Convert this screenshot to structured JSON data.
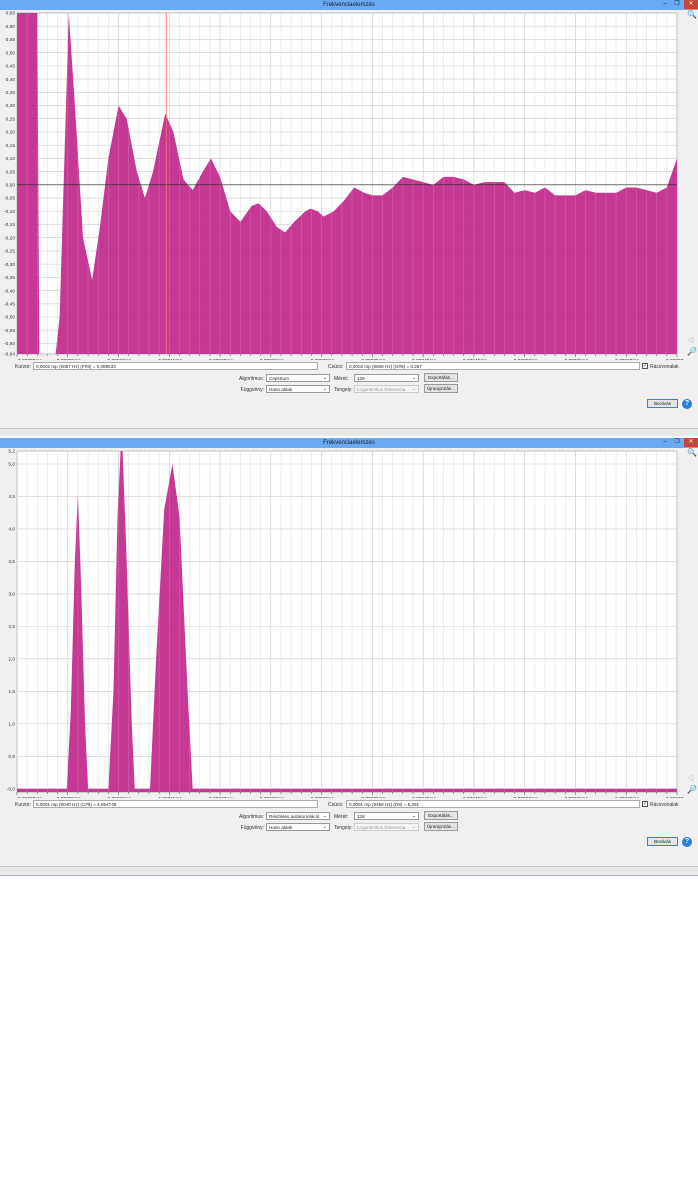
{
  "colors": {
    "fill": "#c22e8f",
    "titlebar": "#6aaaf2",
    "cursor_line": "#ff7070"
  },
  "windows": [
    {
      "title": "Frekvenciaelemzés",
      "cursor_label": "Kurzor:",
      "cursor_value": "0,0002 mp (6057 Hz) (F#8) = 0,088533",
      "peak_label": "Csúcs:",
      "peak_value": "0,0002 mp (6609 Hz) (G#8) = 0,287",
      "grid_label": "Rácsvonalak",
      "grid_checked": true,
      "algorithm_label": "Algoritmus:",
      "algorithm_value": "Cepstrum",
      "size_label": "Méret:",
      "size_value": "128",
      "export_label": "Exportálás...",
      "function_label": "Függvény:",
      "function_value": "Hann ablak",
      "axis_label": "Tengely:",
      "axis_value": "Logaritmikus frekvencia",
      "replot_label": "Újrarajzolás...",
      "close_label": "Bezárás",
      "help_icon": "?"
    },
    {
      "title": "Frekvenciaelemzés",
      "cursor_label": "Kurzor:",
      "cursor_value": "0,0001 mp (9040 Hz) (C#9) = 4,654749",
      "peak_label": "Csúcs:",
      "peak_value": "0,0001 mp (9458 Hz) (D9) = 5,291",
      "grid_label": "Rácsvonalak",
      "grid_checked": true,
      "algorithm_label": "Algoritmus:",
      "algorithm_value": "Részletes autokorreláció",
      "size_label": "Méret:",
      "size_value": "128",
      "export_label": "Exportálás...",
      "function_label": "Függvény:",
      "function_value": "Hann ablak",
      "axis_label": "Tengely:",
      "axis_value": "Logaritmikus frekvencia",
      "replot_label": "Újrarajzolás...",
      "close_label": "Bezárás",
      "help_icon": "?"
    }
  ],
  "chart_data": [
    {
      "type": "area",
      "title": "Cepstrum",
      "xlabel": "mp",
      "ylabel": "",
      "xlim": [
        0,
        0.00065
      ],
      "ylim": [
        -0.64,
        0.65
      ],
      "x_ticks": [
        "0,00000mp",
        "0,00005mp",
        "0,00010mp",
        "0,00015mp",
        "0,00020mp",
        "0,00025mp",
        "0,00030mp",
        "0,00035mp",
        "0,00040mp",
        "0,00045mp",
        "0,00050mp",
        "0,00055mp",
        "0,00060mp",
        "0,00065mp"
      ],
      "y_ticks": [
        {
          "v": 0.65,
          "t": "0,65"
        },
        {
          "v": 0.6,
          "t": "0,60"
        },
        {
          "v": 0.55,
          "t": "0,55"
        },
        {
          "v": 0.5,
          "t": "0,50"
        },
        {
          "v": 0.45,
          "t": "0,45"
        },
        {
          "v": 0.4,
          "t": "0,40"
        },
        {
          "v": 0.35,
          "t": "0,35"
        },
        {
          "v": 0.3,
          "t": "0,30"
        },
        {
          "v": 0.25,
          "t": "0,25"
        },
        {
          "v": 0.2,
          "t": "0,20"
        },
        {
          "v": 0.15,
          "t": "0,15"
        },
        {
          "v": 0.1,
          "t": "0,10"
        },
        {
          "v": 0.05,
          "t": "0,05"
        },
        {
          "v": 0,
          "t": "0,00"
        },
        {
          "v": -0.05,
          "t": "-0,05"
        },
        {
          "v": -0.1,
          "t": "-0,10"
        },
        {
          "v": -0.15,
          "t": "-0,15"
        },
        {
          "v": -0.2,
          "t": "-0,20"
        },
        {
          "v": -0.25,
          "t": "-0,25"
        },
        {
          "v": -0.3,
          "t": "-0,30"
        },
        {
          "v": -0.35,
          "t": "-0,35"
        },
        {
          "v": -0.4,
          "t": "-0,40"
        },
        {
          "v": -0.45,
          "t": "-0,45"
        },
        {
          "v": -0.5,
          "t": "-0,50"
        },
        {
          "v": -0.55,
          "t": "-0,55"
        },
        {
          "v": -0.6,
          "t": "-0,60"
        },
        {
          "v": -0.64,
          "t": "-0,64"
        }
      ],
      "cursor_x": 0.000147,
      "x_units": 1e-05,
      "x": [
        0,
        1,
        2,
        2.2,
        2.3,
        3.8,
        4.2,
        5.1,
        5.7,
        6.5,
        7.4,
        8.2,
        9,
        10,
        10.8,
        11.8,
        12.6,
        13.4,
        14.6,
        15.4,
        16.4,
        17.3,
        18.3,
        19.1,
        20,
        21,
        22,
        23.1,
        23.8,
        24.6,
        25.6,
        26.4,
        27.3,
        28.4,
        28.9,
        29.6,
        30.2,
        31.2,
        32.2,
        33.2,
        34.2,
        35,
        36,
        37,
        38,
        39,
        40,
        41,
        42,
        43,
        44,
        45,
        46,
        47,
        48,
        49,
        50,
        51,
        52,
        53,
        54,
        55,
        56,
        57,
        58,
        59,
        60,
        61,
        62,
        63,
        64,
        65
      ],
      "y": [
        0.65,
        0.65,
        0.65,
        -0.7,
        -0.7,
        -0.7,
        -0.5,
        0.65,
        0.3,
        -0.2,
        -0.36,
        -0.15,
        0.1,
        0.3,
        0.25,
        0.05,
        -0.05,
        0.05,
        0.27,
        0.2,
        0.02,
        -0.02,
        0.05,
        0.1,
        0.03,
        -0.1,
        -0.14,
        -0.08,
        -0.07,
        -0.1,
        -0.16,
        -0.18,
        -0.14,
        -0.1,
        -0.09,
        -0.1,
        -0.12,
        -0.1,
        -0.06,
        -0.01,
        -0.03,
        -0.04,
        -0.04,
        -0.01,
        0.03,
        0.02,
        0.01,
        0.0,
        0.03,
        0.03,
        0.02,
        0.0,
        0.01,
        0.01,
        0.01,
        -0.03,
        -0.02,
        -0.03,
        -0.01,
        -0.04,
        -0.04,
        -0.04,
        -0.02,
        -0.03,
        -0.03,
        -0.03,
        -0.01,
        -0.01,
        -0.02,
        -0.03,
        -0.01,
        0.1
      ]
    },
    {
      "type": "area",
      "title": "Részletes autokorreláció",
      "xlabel": "mp",
      "ylabel": "",
      "xlim": [
        0,
        0.00065
      ],
      "ylim": [
        -0.05,
        5.2
      ],
      "x_ticks": [
        "0,00000mp",
        "0,00005mp",
        "0,00010mp",
        "0,00015mp",
        "0,00020mp",
        "0,00025mp",
        "0,00030mp",
        "0,00035mp",
        "0,00040mp",
        "0,00045mp",
        "0,00050mp",
        "0,00055mp",
        "0,00060mp",
        "0,00065mp"
      ],
      "y_ticks": [
        {
          "v": 5.2,
          "t": "5,2"
        },
        {
          "v": 5.0,
          "t": "5,0"
        },
        {
          "v": 4.5,
          "t": "4,5"
        },
        {
          "v": 4.0,
          "t": "4,0"
        },
        {
          "v": 3.5,
          "t": "3,5"
        },
        {
          "v": 3.0,
          "t": "3,0"
        },
        {
          "v": 2.5,
          "t": "2,5"
        },
        {
          "v": 2.0,
          "t": "2,0"
        },
        {
          "v": 1.5,
          "t": "1,5"
        },
        {
          "v": 1.0,
          "t": "1,0"
        },
        {
          "v": 0.5,
          "t": "0,5"
        },
        {
          "v": 0,
          "t": "-0,0"
        }
      ],
      "cursor_x": null,
      "x_units": 1e-05,
      "x": [
        0,
        4.9,
        5.3,
        5.7,
        6.0,
        6.3,
        6.7,
        7.0,
        9.0,
        9.5,
        9.9,
        10.2,
        10.4,
        10.8,
        11.3,
        11.6,
        13.1,
        13.7,
        14.5,
        15.3,
        16.0,
        16.8,
        17.3,
        65
      ],
      "y": [
        0,
        0,
        1.2,
        3.5,
        4.55,
        3.2,
        1.0,
        0,
        0,
        1.5,
        4.2,
        5.29,
        5.2,
        3.5,
        1.0,
        0,
        0,
        2.0,
        4.3,
        5.0,
        4.2,
        1.5,
        0,
        0
      ]
    }
  ]
}
